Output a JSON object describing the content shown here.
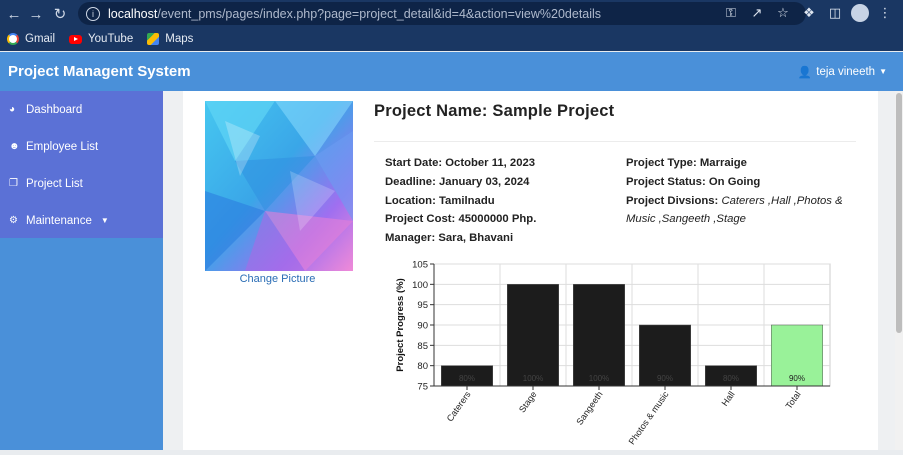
{
  "browser": {
    "url_host": "localhost",
    "url_path": "/event_pms/pages/index.php?page=project_detail&id=4&action=view%20details",
    "bookmarks": [
      "Gmail",
      "YouTube",
      "Maps"
    ]
  },
  "app": {
    "brand": "Project Managent System",
    "user": "teja vineeth"
  },
  "sidebar": {
    "items": [
      {
        "label": "Dashboard",
        "icon": "tachometer-icon"
      },
      {
        "label": "Employee List",
        "icon": "users-icon"
      },
      {
        "label": "Project List",
        "icon": "copy-icon"
      },
      {
        "label": "Maintenance",
        "icon": "cogs-icon"
      }
    ]
  },
  "project": {
    "title_label": "Project Name:",
    "title_value": "Sample Project",
    "change_picture": "Change Picture",
    "start_label": "Start Date:",
    "start_value": "October 11, 2023",
    "deadline_label": "Deadline:",
    "deadline_value": "January 03, 2024",
    "location_label": "Location:",
    "location_value": "Tamilnadu",
    "cost_label": "Project Cost:",
    "cost_value": "45000000 Php.",
    "manager_label": "Manager:",
    "manager_value": "Sara, Bhavani",
    "type_label": "Project Type:",
    "type_value": "Marraige",
    "status_label": "Project Status:",
    "status_value": "On Going",
    "divisions_label": "Project Divsions:",
    "divisions_value": "Caterers ,Hall ,Photos & Music ,Sangeeth ,Stage"
  },
  "chart_data": {
    "type": "bar",
    "categories": [
      "Caterers",
      "Stage",
      "Sangeeth",
      "Photos & music",
      "Hall",
      "Total"
    ],
    "values": [
      80,
      100,
      100,
      90,
      80,
      90
    ],
    "value_labels": [
      "80%",
      "100%",
      "100%",
      "90%",
      "80%",
      "90%"
    ],
    "ylabel": "Project Progress (%)",
    "ylim": [
      75,
      105
    ],
    "yticks": [
      75,
      80,
      85,
      90,
      95,
      100,
      105
    ],
    "colors": [
      "#1c1c1c",
      "#1c1c1c",
      "#1c1c1c",
      "#1c1c1c",
      "#1c1c1c",
      "#99f299"
    ],
    "grid": true
  }
}
